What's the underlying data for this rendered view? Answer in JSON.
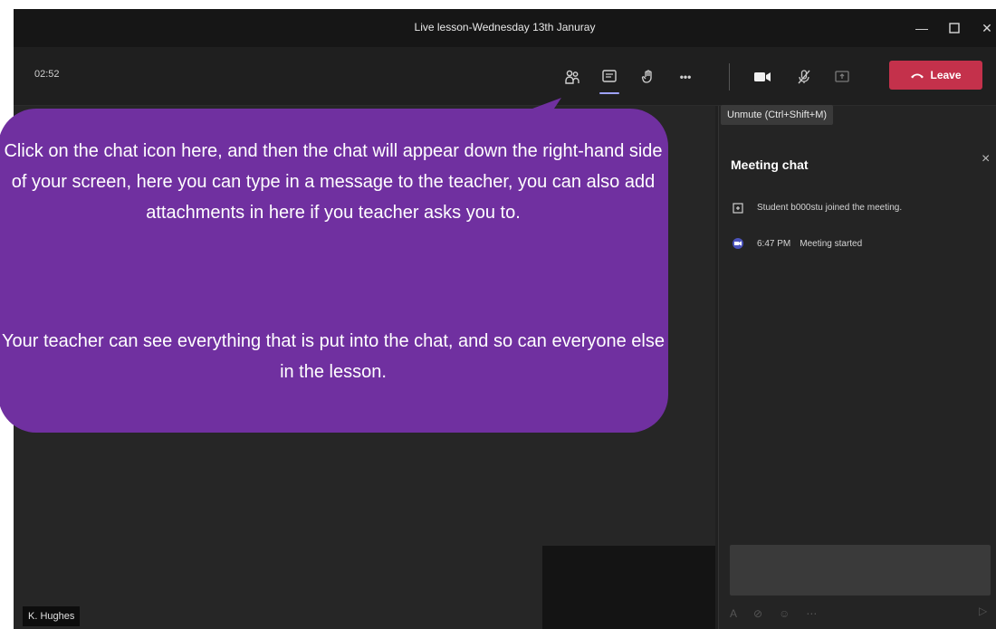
{
  "window": {
    "title": "Live lesson-Wednesday 13th Januray",
    "controls": {
      "minimize_icon": "minimize-icon",
      "maximize_icon": "maximize-icon",
      "close_icon": "close-icon"
    }
  },
  "toolbar": {
    "timer": "02:52",
    "participants_icon": "participants-icon",
    "chat_icon": "chat-icon",
    "raise_hand_icon": "raise-hand-icon",
    "more_label": "•••",
    "camera_icon": "camera-icon",
    "mic_icon": "mic-muted-icon",
    "share_icon": "share-screen-icon",
    "leave_label": "Leave",
    "leave_color": "#c4314b"
  },
  "tooltip": {
    "text": "Unmute (Ctrl+Shift+M)"
  },
  "chat": {
    "title": "Meeting chat",
    "close_label": "×",
    "messages": [
      {
        "icon": "join-icon",
        "text": "Student b000stu joined the meeting."
      },
      {
        "icon": "video-icon",
        "time": "6:47 PM",
        "text": "Meeting started"
      }
    ],
    "action_icons": [
      "format-icon",
      "attach-icon",
      "emoji-icon",
      "more-icon"
    ],
    "send_icon": "send-icon"
  },
  "stage": {
    "name_tag": "K. Hughes"
  },
  "callout": {
    "text1": "Click on the chat icon here, and then the chat will appear down the right-hand side of your screen, here you can type in a message to the teacher, you can also add attachments in here if you teacher asks you to.",
    "text2": "Your teacher can see everything that is put into the chat, and so can everyone else in the lesson.",
    "color": "#7030a0"
  }
}
